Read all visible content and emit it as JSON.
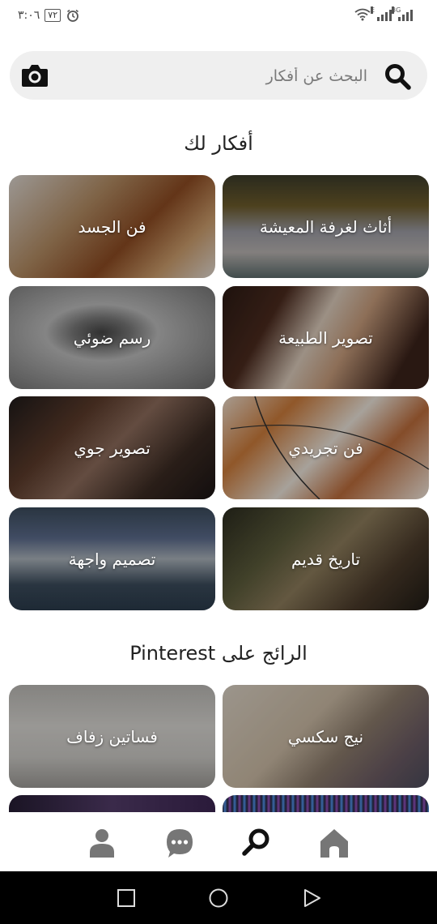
{
  "status_bar": {
    "time": "٣:٠٦",
    "battery": "٧٢",
    "network_1": "E",
    "network_2": "3G"
  },
  "search": {
    "placeholder": "البحث عن أفكار"
  },
  "sections": {
    "ideas_title": "أفكار لك",
    "trending_title": "الرائج على Pinterest"
  },
  "ideas": [
    {
      "label": "فن الجسد"
    },
    {
      "label": "أثاث لغرفة المعيشة"
    },
    {
      "label": "رسم ضوئي"
    },
    {
      "label": "تصوير الطبيعة"
    },
    {
      "label": "تصوير جوي"
    },
    {
      "label": "فن تجريدي"
    },
    {
      "label": "تصميم واجهة"
    },
    {
      "label": "تاريخ قديم"
    }
  ],
  "trending": [
    {
      "label": "فساتين زفاف"
    },
    {
      "label": "نيج سكسي"
    }
  ],
  "bottom_nav": [
    "profile",
    "messages",
    "search",
    "home"
  ],
  "colors": {
    "search_bg": "#efefef",
    "icon_dark": "#111111",
    "nav_icon": "#767676",
    "system_nav_bg": "#000000"
  }
}
